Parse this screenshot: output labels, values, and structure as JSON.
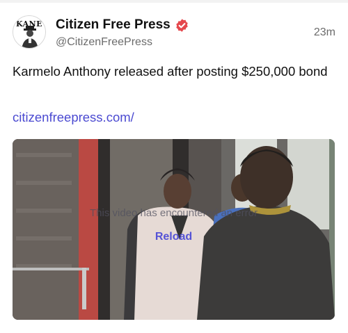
{
  "post": {
    "author": {
      "display_name": "Citizen Free Press",
      "handle": "@CitizenFreePress",
      "avatar_text": "KANE",
      "verified_icon": "verified-badge-icon",
      "verified_color": "#e5484d"
    },
    "timestamp": "23m",
    "text": "Karmelo Anthony released after posting $250,000 bond",
    "link": "citizenfreepress.com/",
    "video": {
      "error_message": "This video has encountered an error",
      "reload_label": "Reload"
    }
  },
  "colors": {
    "link": "#4b4ad1",
    "secondary_text": "#6b6b6b",
    "reload": "#5553d6"
  }
}
